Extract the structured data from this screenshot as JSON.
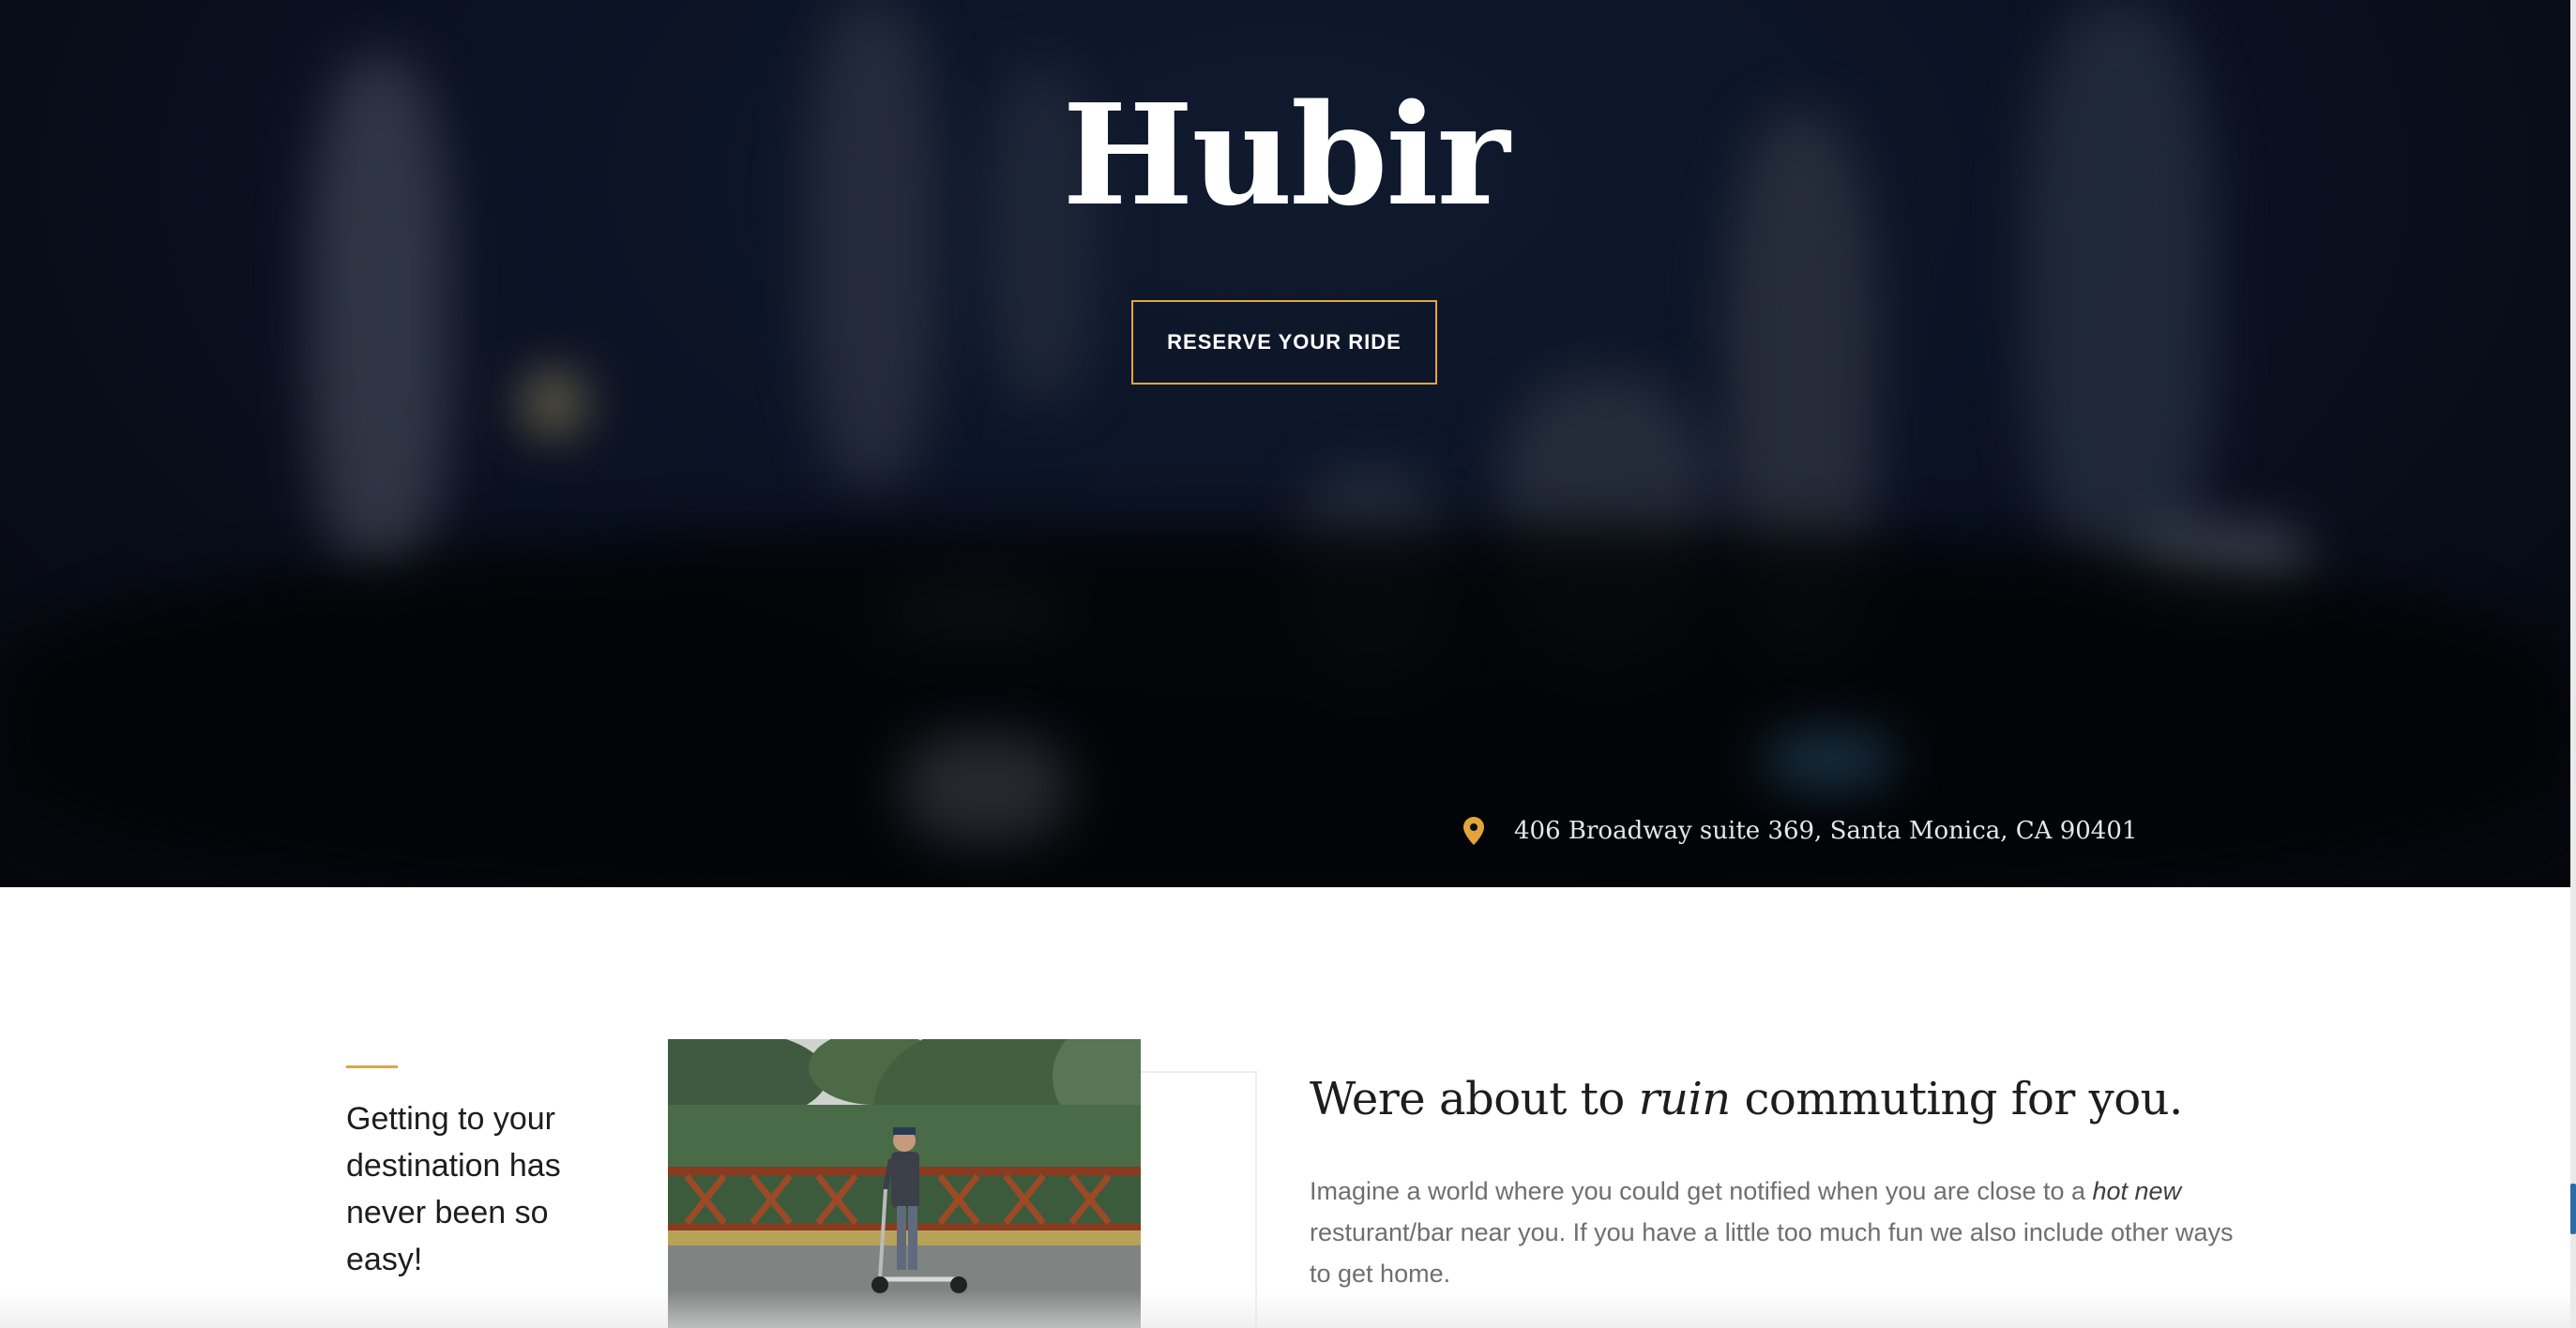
{
  "hero": {
    "title": "Hubir",
    "cta_label": "RESERVE YOUR RIDE",
    "address": "406 Broadway suite 369, Santa Monica, CA 90401",
    "icons": {
      "address": "map-pin-icon"
    }
  },
  "intro": {
    "tagline": "Getting to your destination has never been so easy!",
    "heading_before": "Were about to ",
    "heading_emphasis": "ruin",
    "heading_after": " commuting for you.",
    "body_before": "Imagine a world where you could get notified when you are close to a ",
    "body_emphasis": "hot new",
    "body_after": " resturant/bar near you. If you have a little too much fun we also include other ways to get home."
  },
  "colors": {
    "accent": "#e3a43c",
    "hero_bg": "#0b1224",
    "text_dark": "#1d1d1d",
    "text_muted": "#6f6f6f"
  }
}
